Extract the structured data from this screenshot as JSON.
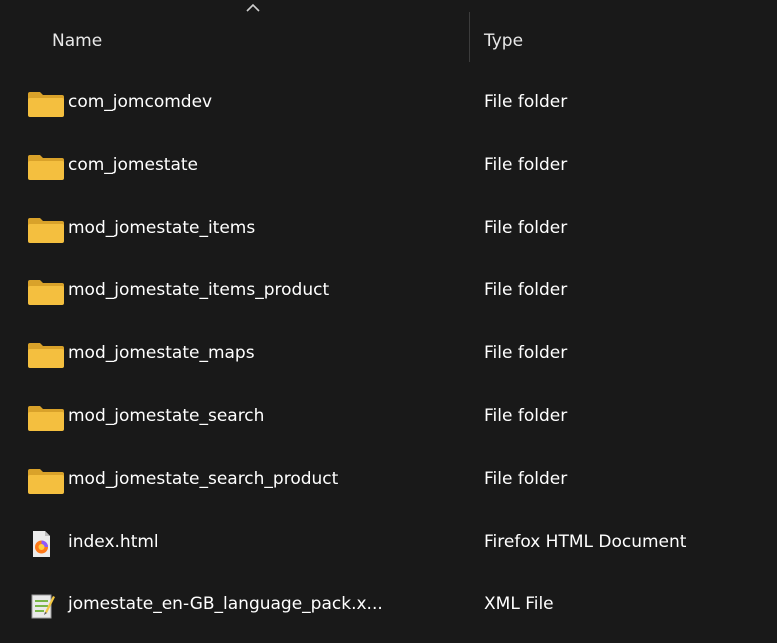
{
  "header": {
    "name_label": "Name",
    "type_label": "Type",
    "sort_direction": "ascending"
  },
  "files": [
    {
      "name": "com_jomcomdev",
      "type": "File folder",
      "icon": "folder-icon"
    },
    {
      "name": "com_jomestate",
      "type": "File folder",
      "icon": "folder-icon"
    },
    {
      "name": "mod_jomestate_items",
      "type": "File folder",
      "icon": "folder-icon"
    },
    {
      "name": "mod_jomestate_items_product",
      "type": "File folder",
      "icon": "folder-icon"
    },
    {
      "name": "mod_jomestate_maps",
      "type": "File folder",
      "icon": "folder-icon"
    },
    {
      "name": "mod_jomestate_search",
      "type": "File folder",
      "icon": "folder-icon"
    },
    {
      "name": "mod_jomestate_search_product",
      "type": "File folder",
      "icon": "folder-icon"
    },
    {
      "name": "index.html",
      "type": "Firefox HTML Document",
      "icon": "firefox-html-icon"
    },
    {
      "name": "jomestate_en-GB_language_pack.x...",
      "type": "XML File",
      "icon": "xml-file-icon"
    }
  ],
  "colors": {
    "background": "#191919",
    "folder": "#f4bf3f",
    "folder_dark": "#d9a22a",
    "text": "#ffffff"
  }
}
